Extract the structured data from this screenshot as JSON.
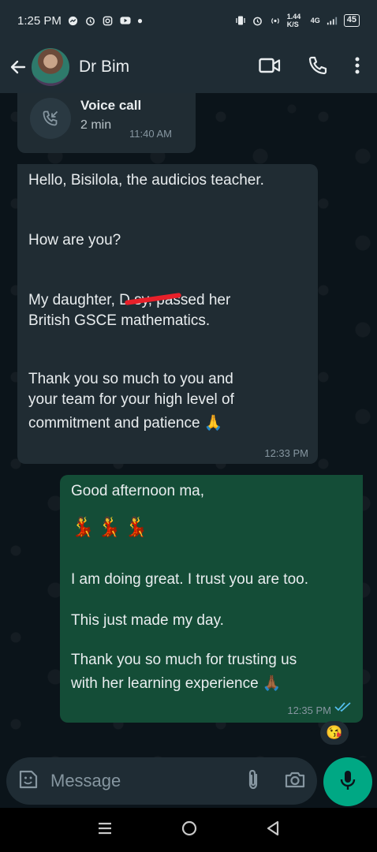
{
  "status_bar": {
    "time": "1:25 PM",
    "net_speed": "1.44 K/S",
    "network": "4G",
    "battery": "45"
  },
  "header": {
    "contact_name": "Dr Bim"
  },
  "call_log": {
    "title": "Voice call",
    "duration": "2 min",
    "time": "11:40 AM"
  },
  "incoming_message": {
    "lines": [
      "Hello, Bisilola, the audicios teacher.",
      "How are you?",
      "My daughter, D    sy, passed her",
      "British GSCE mathematics.",
      "Thank you so much to you and",
      "your team for your high level of",
      "commitment and patience 🙏"
    ],
    "time": "12:33 PM"
  },
  "outgoing_message": {
    "greeting": "Good afternoon ma,",
    "emojis": [
      "💃",
      "💃",
      "💃"
    ],
    "line1": "I am doing great. I trust you are too.",
    "line2": "This just made my day.",
    "line3": "Thank you so much for trusting us",
    "line4": "with her learning experience 🙏🏾",
    "time": "12:35 PM"
  },
  "reaction": "😘",
  "input": {
    "placeholder": "Message"
  },
  "colors": {
    "chat_bg": "#0b141a",
    "bubble_in": "#202c33",
    "bubble_out": "#144d37",
    "accent": "#00a884",
    "read_ticks": "#53bdeb"
  }
}
